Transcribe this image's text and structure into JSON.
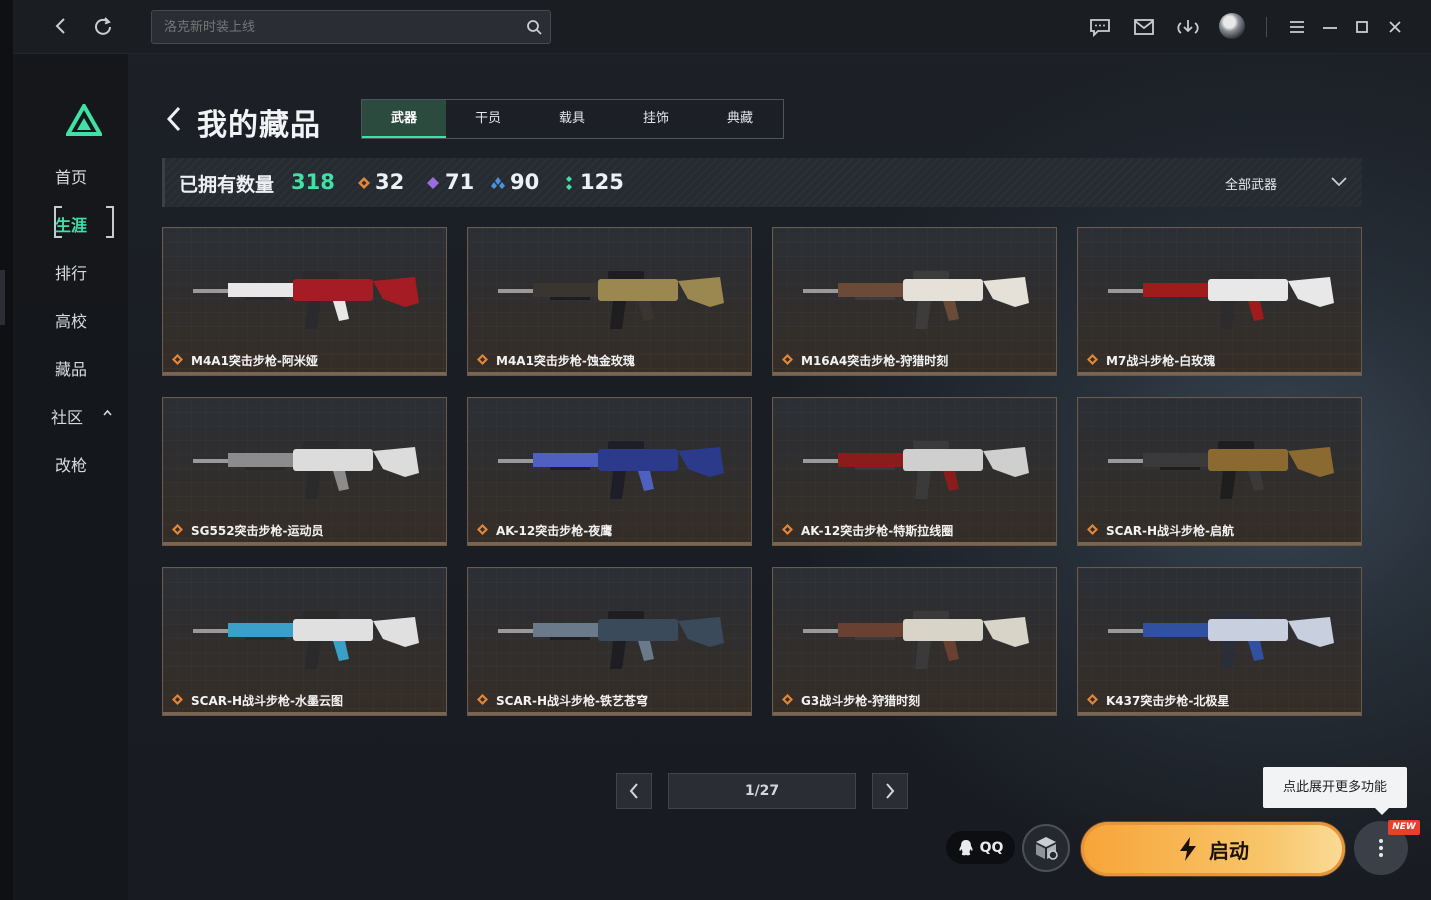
{
  "topbar": {
    "search_placeholder": "洛克新时装上线"
  },
  "sidebar": {
    "items": [
      {
        "label": "首页"
      },
      {
        "label": "生涯"
      },
      {
        "label": "排行"
      },
      {
        "label": "高校"
      },
      {
        "label": "藏品"
      },
      {
        "label": "社区"
      },
      {
        "label": "改枪"
      }
    ]
  },
  "page": {
    "title": "我的藏品",
    "tabs": [
      {
        "label": "武器"
      },
      {
        "label": "干员"
      },
      {
        "label": "载具"
      },
      {
        "label": "挂饰"
      },
      {
        "label": "典藏"
      }
    ]
  },
  "stats": {
    "owned_label": "已拥有数量",
    "owned_count": "318",
    "orange_count": "32",
    "purple_count": "71",
    "blue_count": "90",
    "green_count": "125",
    "filter_label": "全部武器"
  },
  "colors": {
    "accent": "#3fe1a4",
    "orange_rarity": "#e2873a",
    "purple_rarity": "#9b6be0",
    "blue_rarity": "#4f8fe0",
    "green_rarity": "#3fe1a4",
    "launch": "#f7a438"
  },
  "items": [
    {
      "name": "M4A1突击步枪-阿米娅"
    },
    {
      "name": "M4A1突击步枪-蚀金玫瑰"
    },
    {
      "name": "M16A4突击步枪-狩猎时刻"
    },
    {
      "name": "M7战斗步枪-白玫瑰"
    },
    {
      "name": "SG552突击步枪-运动员"
    },
    {
      "name": "AK-12突击步枪-夜鹰"
    },
    {
      "name": "AK-12突击步枪-特斯拉线圈"
    },
    {
      "name": "SCAR-H战斗步枪-启航"
    },
    {
      "name": "SCAR-H战斗步枪-水墨云图"
    },
    {
      "name": "SCAR-H战斗步枪-铁艺苍穹"
    },
    {
      "name": "G3战斗步枪-狩猎时刻"
    },
    {
      "name": "K437突击步枪-北极星"
    }
  ],
  "pager": {
    "text": "1/27"
  },
  "footer": {
    "tooltip": "点此展开更多功能",
    "qq_label": "QQ",
    "launch_label": "启动",
    "new_badge": "NEW"
  }
}
